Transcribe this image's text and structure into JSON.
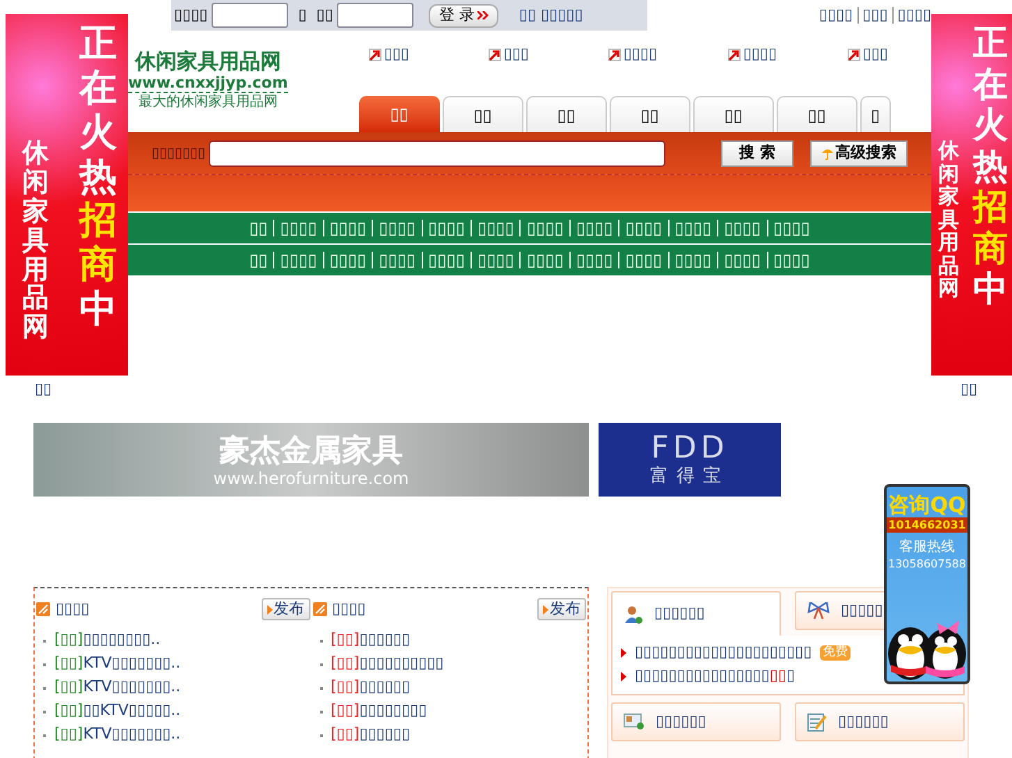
{
  "top_bar": {
    "user_label": "▯▯▯▯",
    "separator": "▯",
    "password_label": "▯▯",
    "login_button": "登 录",
    "register_link": "▯▯ ▯▯▯▯▯",
    "right_links": [
      "▯▯▯▯",
      "▯▯▯",
      "▯▯▯▯"
    ]
  },
  "logo": {
    "title": "休闲家具用品网",
    "url": "www.cnxxjjyp.com",
    "slogan": "最大的休闲家具用品网"
  },
  "quick_links": [
    "▯▯▯",
    "▯▯▯",
    "▯▯▯▯",
    "▯▯▯▯",
    "▯▯▯"
  ],
  "tabs": [
    {
      "label": "▯▯",
      "selected": true
    },
    {
      "label": "▯▯",
      "selected": false
    },
    {
      "label": "▯▯",
      "selected": false
    },
    {
      "label": "▯▯",
      "selected": false
    },
    {
      "label": "▯▯",
      "selected": false
    },
    {
      "label": "▯▯",
      "selected": false
    },
    {
      "label": "▯",
      "selected": false
    }
  ],
  "search": {
    "label": "▯▯▯▯▯▯▯",
    "button": "搜 索",
    "advanced_button": "高级搜索"
  },
  "nav_rows": [
    [
      "▯▯",
      "▯▯▯▯",
      "▯▯▯▯",
      "▯▯▯▯",
      "▯▯▯▯",
      "▯▯▯▯",
      "▯▯▯▯",
      "▯▯▯▯",
      "▯▯▯▯",
      "▯▯▯▯",
      "▯▯▯▯",
      "▯▯▯▯"
    ],
    [
      "▯▯",
      "▯▯▯▯",
      "▯▯▯▯",
      "▯▯▯▯",
      "▯▯▯▯",
      "▯▯▯▯",
      "▯▯▯▯",
      "▯▯▯▯",
      "▯▯▯▯",
      "▯▯▯▯",
      "▯▯▯▯",
      "▯▯▯▯"
    ]
  ],
  "side_banners": [
    {
      "headline_start": "正在火热",
      "headline_accent": "招商",
      "headline_end": "中",
      "subtitle": "休闲家具用品网",
      "caption": "▯▯"
    },
    {
      "headline_start": "正在火热",
      "headline_accent": "招商",
      "headline_end": "中",
      "subtitle": "休闲家具用品网",
      "caption": "▯▯"
    }
  ],
  "ads": [
    {
      "title": "豪杰金属家具",
      "url": "www.herofurniture.com"
    },
    {
      "brand": "FDD",
      "name": "富得宝"
    }
  ],
  "listings": [
    {
      "title": "▯▯▯▯",
      "publish_button": "发布",
      "color": "#228b22",
      "items": [
        {
          "tag": "[▯▯]",
          "text": "▯▯▯▯▯▯▯▯.."
        },
        {
          "tag": "[▯▯]",
          "text": "KTV▯▯▯▯▯▯▯.."
        },
        {
          "tag": "[▯▯]",
          "text": "KTV▯▯▯▯▯▯▯.."
        },
        {
          "tag": "[▯▯]",
          "text": "▯▯KTV▯▯▯▯▯.."
        },
        {
          "tag": "[▯▯]",
          "text": "KTV▯▯▯▯▯▯▯.."
        }
      ]
    },
    {
      "title": "▯▯▯▯",
      "publish_button": "发布",
      "color": "#ee2222",
      "items": [
        {
          "tag": "[▯▯]",
          "text": "▯▯▯▯▯▯"
        },
        {
          "tag": "[▯▯]",
          "text": "▯▯▯▯▯▯▯▯▯▯"
        },
        {
          "tag": "[▯▯]",
          "text": "▯▯▯▯▯▯"
        },
        {
          "tag": "[▯▯]",
          "text": "▯▯▯▯▯▯▯▯"
        },
        {
          "tag": "[▯▯]",
          "text": "▯▯▯▯▯▯"
        }
      ]
    }
  ],
  "service_cards": [
    {
      "title": "▯▯▯▯▯▯",
      "expanded": true,
      "lines": [
        {
          "text": "▯▯▯▯▯▯▯▯▯▯▯▯▯▯▯▯▯▯▯▯▯",
          "badge": "免费"
        },
        {
          "text": "▯▯▯▯▯▯▯▯▯▯▯▯▯▯▯▯",
          "highlight": "▯▯",
          "tail": "▯"
        }
      ]
    },
    {
      "title": "▯▯▯▯▯",
      "expanded": false
    },
    {
      "title": "▯▯▯▯▯▯",
      "expanded": false
    },
    {
      "title": "▯▯▯▯▯▯",
      "expanded": false
    }
  ],
  "qq_widget": {
    "title": "咨询QQ",
    "number": "1014662031",
    "hotline_label": "客服热线",
    "hotline": "13058607588"
  }
}
